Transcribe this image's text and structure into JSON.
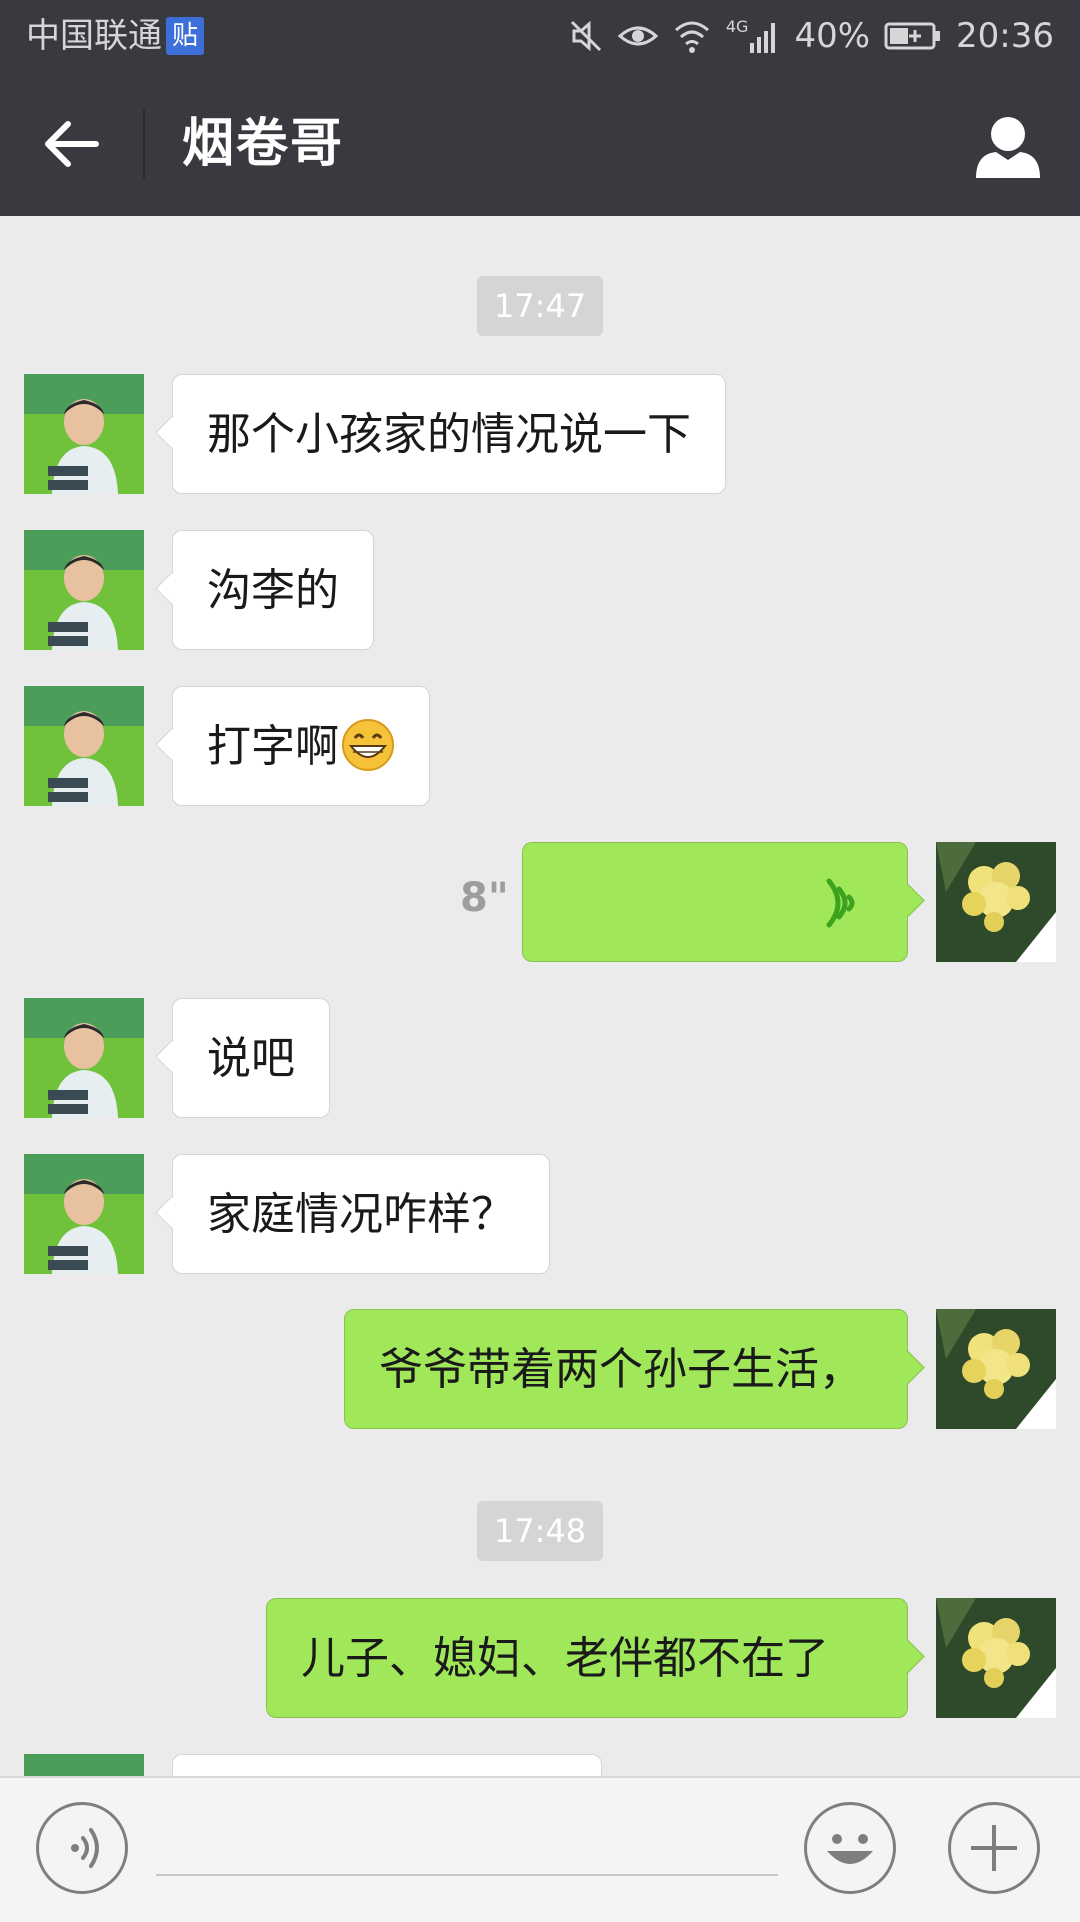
{
  "status_bar": {
    "carrier": "中国联通",
    "carrier_badge": "贴",
    "network": "4G",
    "battery": "40%",
    "time": "20:36"
  },
  "nav": {
    "title": "烟卷哥"
  },
  "messages": {
    "time1": "17:47",
    "m1": "那个小孩家的情况说一下",
    "m2": "沟李的",
    "m3": "打字啊",
    "m4_duration": "8\"",
    "m5": "说吧",
    "m6": "家庭情况咋样？",
    "m7": "爷爷带着两个孙子生活，",
    "time2": "17:48",
    "m8": "儿子、媳妇、老伴都不在了"
  },
  "colors": {
    "bar_bg": "#393a3f",
    "chat_bg": "#ebebeb",
    "sent_bubble": "#a0e75a",
    "received_bubble": "#ffffff"
  },
  "icons": {
    "back": "arrow-left-icon",
    "profile": "person-icon",
    "voice": "voice-wave-icon",
    "emoji": "smiley-icon",
    "plus": "plus-icon"
  }
}
